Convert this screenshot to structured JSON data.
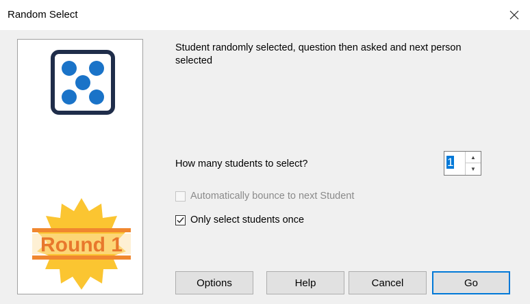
{
  "window": {
    "title": "Random Select",
    "close_icon": "close-icon"
  },
  "image_panel": {
    "dice_icon": "dice-five-icon",
    "badge_text": "Round 1",
    "colors": {
      "dice_dots": "#1a73c8",
      "dice_border": "#1f2d4a",
      "badge_sun": "#fbc531",
      "badge_band": "#f0872f",
      "badge_text": "#e8782c"
    }
  },
  "description": "Student randomly selected, question then asked and next person selected",
  "count": {
    "label": "How many students to select?",
    "value": "1"
  },
  "options": {
    "auto_bounce": {
      "label": "Automatically bounce to next Student",
      "checked": false,
      "enabled": false
    },
    "select_once": {
      "label": "Only select students once",
      "checked": true,
      "enabled": true
    }
  },
  "buttons": {
    "options": "Options",
    "help": "Help",
    "cancel": "Cancel",
    "go": "Go"
  }
}
